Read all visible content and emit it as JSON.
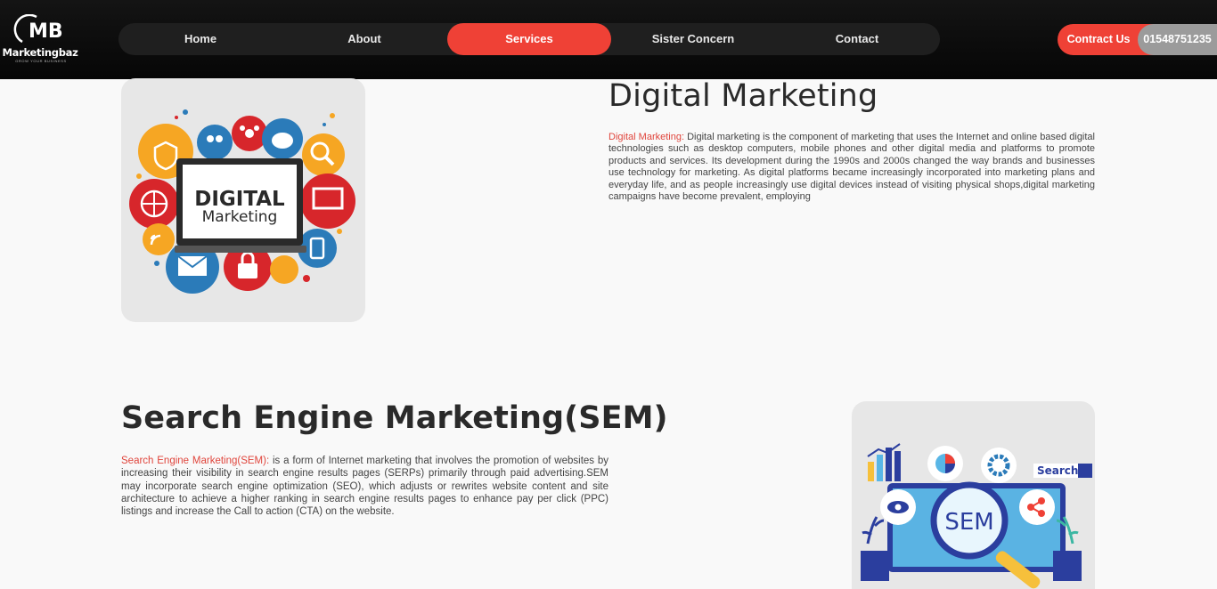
{
  "logo": {
    "mark": "MB",
    "name": "Marketingbaz",
    "tagline": "GROW YOUR BUSINESS"
  },
  "nav": {
    "items": [
      {
        "label": "Home"
      },
      {
        "label": "About"
      },
      {
        "label": "Services"
      },
      {
        "label": "Sister Concern"
      },
      {
        "label": "Contact"
      }
    ],
    "active": "Services",
    "accent_color": "#ef4136"
  },
  "contact": {
    "label": "Contract Us",
    "phone": "01548751235"
  },
  "sections": [
    {
      "title": "Digital Marketing",
      "lead": "Digital Marketing:",
      "body": " Digital marketing is the component of marketing that uses the Internet and online based digital technologies such as desktop computers, mobile phones and other digital media and platforms to promote products and services. Its development during the 1990s and 2000s changed the way brands and businesses use technology for marketing. As digital platforms became increasingly incorporated into marketing plans and everyday life, and as people increasingly use digital devices instead of visiting physical shops,digital marketing campaigns have become prevalent, employing",
      "image": {
        "line1": "DIGITAL",
        "line2": "Marketing"
      }
    },
    {
      "title": "Search Engine Marketing(SEM)",
      "lead": "Search Engine Marketing(SEM):",
      "body": "  is a form of Internet marketing that involves the promotion of websites by increasing their visibility in search engine results pages (SERPs) primarily through paid advertising.SEM may incorporate search engine optimization (SEO), which adjusts or rewrites website content and site architecture to achieve a higher ranking in search engine results pages to enhance pay per click (PPC) listings and increase the Call to action (CTA) on the website.",
      "image": {
        "search_label": "Search",
        "badge": "SEM"
      }
    }
  ]
}
